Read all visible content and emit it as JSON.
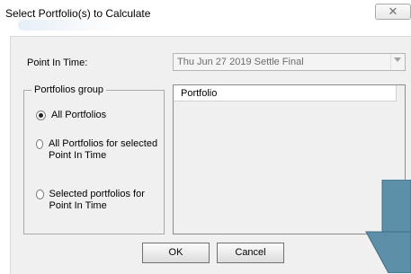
{
  "dialog": {
    "title": "Select Portfolio(s) to Calculate",
    "close_glyph": "☒"
  },
  "point_in_time": {
    "label": "Point In Time:",
    "value": "Thu Jun 27 2019 Settle Final"
  },
  "portfolios_group": {
    "legend": "Portfolios group",
    "options": [
      {
        "label": "All Portfolios",
        "checked": true
      },
      {
        "label": "All Portfolios for selected Point In Time",
        "checked": false
      },
      {
        "label": "Selected portfolios for Point In Time",
        "checked": false
      }
    ]
  },
  "portfolio_list": {
    "column_header": "Portfolio"
  },
  "buttons": {
    "ok": "OK",
    "cancel": "Cancel"
  },
  "colors": {
    "dialog_bg": "#f0f0f0",
    "annotation_arrow": "#5d8fa8"
  }
}
